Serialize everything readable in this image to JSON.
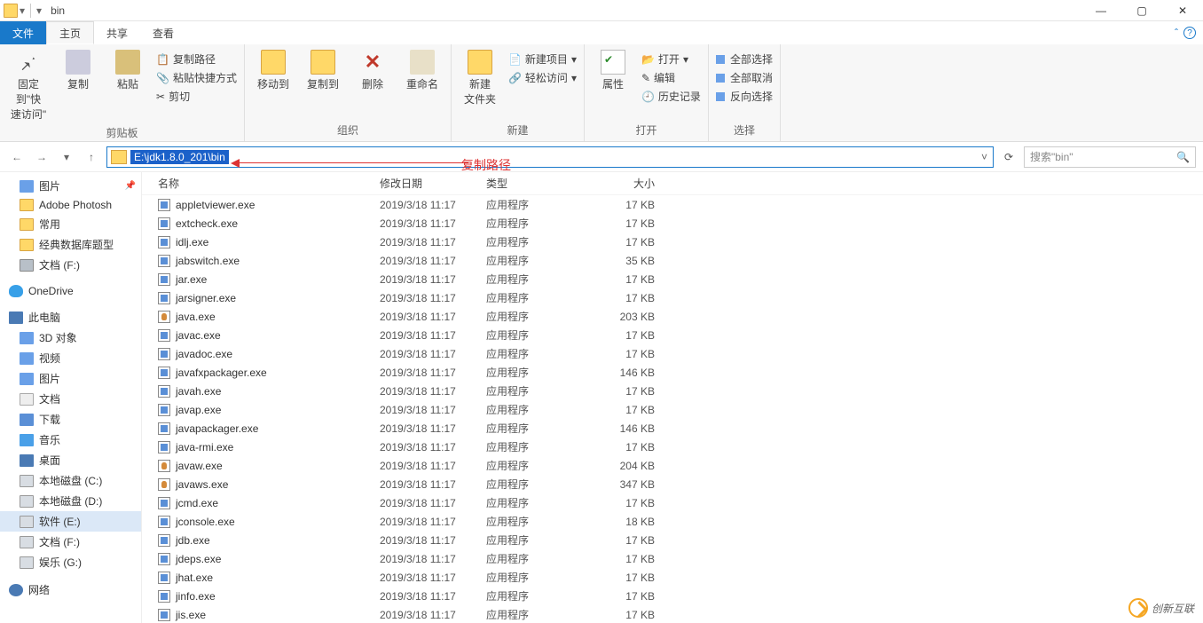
{
  "window": {
    "title": "bin"
  },
  "tabs": {
    "file": "文件",
    "home": "主页",
    "share": "共享",
    "view": "查看"
  },
  "ribbon": {
    "clipboard": {
      "label": "剪贴板",
      "pin": "固定到\"快\n速访问\"",
      "copy": "复制",
      "paste": "粘贴",
      "copy_path": "复制路径",
      "paste_shortcut": "粘贴快捷方式",
      "cut": "剪切"
    },
    "organize": {
      "label": "组织",
      "move_to": "移动到",
      "copy_to": "复制到",
      "delete": "删除",
      "rename": "重命名"
    },
    "new": {
      "label": "新建",
      "new_folder": "新建\n文件夹",
      "new_item": "新建项目",
      "easy_access": "轻松访问"
    },
    "open": {
      "label": "打开",
      "properties": "属性",
      "open": "打开",
      "edit": "编辑",
      "history": "历史记录"
    },
    "select": {
      "label": "选择",
      "select_all": "全部选择",
      "select_none": "全部取消",
      "invert": "反向选择"
    }
  },
  "address": {
    "path": "E:\\jdk1.8.0_201\\bin"
  },
  "search": {
    "placeholder": "搜索\"bin\""
  },
  "annotation": {
    "text": "复制路径"
  },
  "columns": {
    "name": "名称",
    "modified": "修改日期",
    "type": "类型",
    "size": "大小"
  },
  "sidebar": {
    "pictures": "图片",
    "adobe": "Adobe Photosh",
    "common": "常用",
    "db": "经典数据库题型",
    "docs_f": "文档 (F:)",
    "onedrive": "OneDrive",
    "this_pc": "此电脑",
    "objects3d": "3D 对象",
    "videos": "视频",
    "pictures2": "图片",
    "documents": "文档",
    "downloads": "下载",
    "music": "音乐",
    "desktop": "桌面",
    "disk_c": "本地磁盘 (C:)",
    "disk_d": "本地磁盘 (D:)",
    "disk_e": "软件 (E:)",
    "disk_f": "文档 (F:)",
    "disk_g": "娱乐 (G:)",
    "network": "网络"
  },
  "files": [
    {
      "name": "appletviewer.exe",
      "date": "2019/3/18 11:17",
      "type": "应用程序",
      "size": "17 KB",
      "icon": "exe"
    },
    {
      "name": "extcheck.exe",
      "date": "2019/3/18 11:17",
      "type": "应用程序",
      "size": "17 KB",
      "icon": "exe"
    },
    {
      "name": "idlj.exe",
      "date": "2019/3/18 11:17",
      "type": "应用程序",
      "size": "17 KB",
      "icon": "exe"
    },
    {
      "name": "jabswitch.exe",
      "date": "2019/3/18 11:17",
      "type": "应用程序",
      "size": "35 KB",
      "icon": "exe"
    },
    {
      "name": "jar.exe",
      "date": "2019/3/18 11:17",
      "type": "应用程序",
      "size": "17 KB",
      "icon": "exe"
    },
    {
      "name": "jarsigner.exe",
      "date": "2019/3/18 11:17",
      "type": "应用程序",
      "size": "17 KB",
      "icon": "exe"
    },
    {
      "name": "java.exe",
      "date": "2019/3/18 11:17",
      "type": "应用程序",
      "size": "203 KB",
      "icon": "java"
    },
    {
      "name": "javac.exe",
      "date": "2019/3/18 11:17",
      "type": "应用程序",
      "size": "17 KB",
      "icon": "exe"
    },
    {
      "name": "javadoc.exe",
      "date": "2019/3/18 11:17",
      "type": "应用程序",
      "size": "17 KB",
      "icon": "exe"
    },
    {
      "name": "javafxpackager.exe",
      "date": "2019/3/18 11:17",
      "type": "应用程序",
      "size": "146 KB",
      "icon": "exe"
    },
    {
      "name": "javah.exe",
      "date": "2019/3/18 11:17",
      "type": "应用程序",
      "size": "17 KB",
      "icon": "exe"
    },
    {
      "name": "javap.exe",
      "date": "2019/3/18 11:17",
      "type": "应用程序",
      "size": "17 KB",
      "icon": "exe"
    },
    {
      "name": "javapackager.exe",
      "date": "2019/3/18 11:17",
      "type": "应用程序",
      "size": "146 KB",
      "icon": "exe"
    },
    {
      "name": "java-rmi.exe",
      "date": "2019/3/18 11:17",
      "type": "应用程序",
      "size": "17 KB",
      "icon": "exe"
    },
    {
      "name": "javaw.exe",
      "date": "2019/3/18 11:17",
      "type": "应用程序",
      "size": "204 KB",
      "icon": "java"
    },
    {
      "name": "javaws.exe",
      "date": "2019/3/18 11:17",
      "type": "应用程序",
      "size": "347 KB",
      "icon": "java"
    },
    {
      "name": "jcmd.exe",
      "date": "2019/3/18 11:17",
      "type": "应用程序",
      "size": "17 KB",
      "icon": "exe"
    },
    {
      "name": "jconsole.exe",
      "date": "2019/3/18 11:17",
      "type": "应用程序",
      "size": "18 KB",
      "icon": "exe"
    },
    {
      "name": "jdb.exe",
      "date": "2019/3/18 11:17",
      "type": "应用程序",
      "size": "17 KB",
      "icon": "exe"
    },
    {
      "name": "jdeps.exe",
      "date": "2019/3/18 11:17",
      "type": "应用程序",
      "size": "17 KB",
      "icon": "exe"
    },
    {
      "name": "jhat.exe",
      "date": "2019/3/18 11:17",
      "type": "应用程序",
      "size": "17 KB",
      "icon": "exe"
    },
    {
      "name": "jinfo.exe",
      "date": "2019/3/18 11:17",
      "type": "应用程序",
      "size": "17 KB",
      "icon": "exe"
    },
    {
      "name": "jis.exe",
      "date": "2019/3/18 11:17",
      "type": "应用程序",
      "size": "17 KB",
      "icon": "exe"
    }
  ],
  "watermark": {
    "text": "创新互联"
  }
}
